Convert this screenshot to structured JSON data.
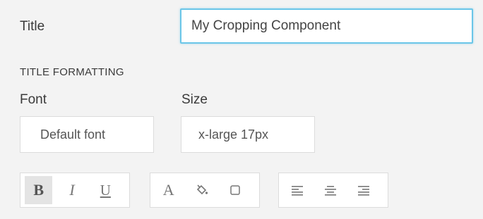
{
  "title_row": {
    "label": "Title",
    "value": "My Cropping Component"
  },
  "formatting": {
    "heading": "TITLE FORMATTING",
    "font_label": "Font",
    "size_label": "Size",
    "font_value": "Default font",
    "size_value": "x-large 17px"
  },
  "toolbar": {
    "style": {
      "bold": "B",
      "italic": "I",
      "underline": "U",
      "bold_active": true
    },
    "color": {
      "text_color": "A",
      "fill_icon": "paint-bucket-icon",
      "border_icon": "square-outline-icon"
    },
    "align": {
      "left_icon": "align-left-icon",
      "center_icon": "align-center-icon",
      "right_icon": "align-right-icon"
    }
  },
  "colors": {
    "focus_border": "#6bc6e8",
    "background": "#f3f3f3"
  }
}
